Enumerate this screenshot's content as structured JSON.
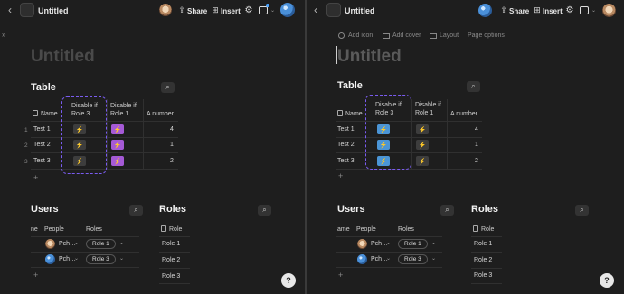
{
  "left": {
    "title": "Untitled",
    "share": "Share",
    "insert": "Insert",
    "page_title": "Untitled",
    "gutter": "»",
    "table": {
      "heading": "Table",
      "col_name": "Name",
      "col_disable3": "Disable if Role 3",
      "col_disable1": "Disable if Role 1",
      "col_number": "A number",
      "rows": [
        {
          "num": "1",
          "name": "Test 1",
          "value": "4"
        },
        {
          "num": "2",
          "name": "Test 2",
          "value": "1"
        },
        {
          "num": "3",
          "name": "Test 3",
          "value": "2"
        }
      ],
      "add": "+"
    },
    "users": {
      "heading": "Users",
      "col_first": "ne",
      "col_people": "People",
      "col_roles": "Roles",
      "rows": [
        {
          "person": "Pch…",
          "role": "Role 1"
        },
        {
          "person": "Pch…",
          "role": "Role 3"
        }
      ],
      "add": "+"
    },
    "roles": {
      "heading": "Roles",
      "col": "Role",
      "rows": [
        "Role 1",
        "Role 2",
        "Role 3"
      ]
    },
    "help": "?"
  },
  "right": {
    "title": "Untitled",
    "share": "Share",
    "insert": "Insert",
    "page_options": {
      "add_icon": "Add icon",
      "add_cover": "Add cover",
      "layout": "Layout",
      "page_options": "Page options"
    },
    "page_title": "Untitled",
    "table": {
      "heading": "Table",
      "col_name": "Name",
      "col_disable3": "Disable if Role 3",
      "col_disable1": "Disable if Role 1",
      "col_number": "A number",
      "rows": [
        {
          "name": "Test 1",
          "value": "4"
        },
        {
          "name": "Test 2",
          "value": "1"
        },
        {
          "name": "Test 3",
          "value": "2"
        }
      ],
      "add": "+"
    },
    "users": {
      "heading": "Users",
      "col_first": "ame",
      "col_people": "People",
      "col_roles": "Roles",
      "rows": [
        {
          "person": "Pch…",
          "role": "Role 1"
        },
        {
          "person": "Pch…",
          "role": "Role 3"
        }
      ],
      "add": "+"
    },
    "roles": {
      "heading": "Roles",
      "col": "Role",
      "rows": [
        "Role 1",
        "Role 2",
        "Role 3"
      ]
    },
    "help": "?"
  },
  "icons": {
    "bolt": "⚡",
    "back": "‹",
    "chevron": "⌄",
    "search": "⌕",
    "gear": "⚙",
    "share_glyph": "⇪",
    "insert_glyph": "⊞"
  },
  "colors": {
    "purple_button": "#a55ad6",
    "blue_button": "#4b95d6",
    "dashed_outline": "#7a5cf0"
  }
}
